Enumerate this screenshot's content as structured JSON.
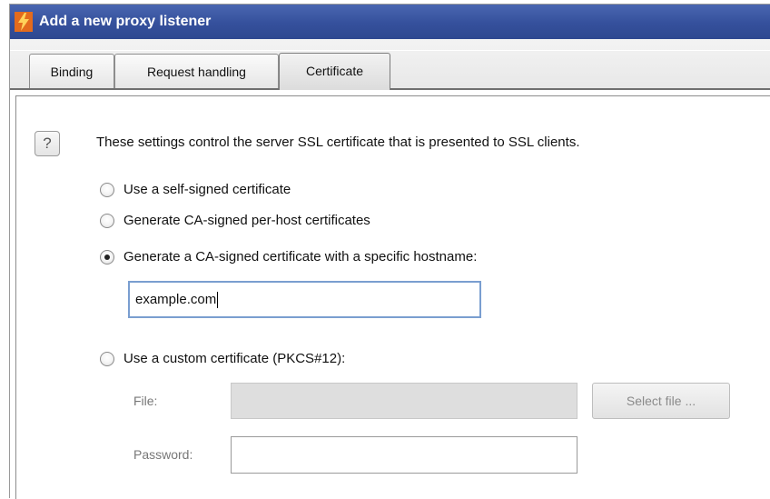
{
  "window": {
    "title": "Add a new proxy listener",
    "icon": "lightning-app-icon"
  },
  "tabs": [
    {
      "label": "Binding",
      "active": false
    },
    {
      "label": "Request handling",
      "active": false
    },
    {
      "label": "Certificate",
      "active": true
    }
  ],
  "certificate": {
    "help_label": "?",
    "description": "These settings control the server SSL certificate that is presented to SSL clients.",
    "options": [
      {
        "label": "Use a self-signed certificate",
        "selected": false
      },
      {
        "label": "Generate CA-signed per-host certificates",
        "selected": false
      },
      {
        "label": "Generate a CA-signed certificate with a specific hostname:",
        "selected": true
      },
      {
        "label": "Use a custom certificate (PKCS#12):",
        "selected": false
      }
    ],
    "hostname_value": "example.com",
    "file_label": "File:",
    "file_value": "",
    "select_file_label": "Select file ...",
    "password_label": "Password:",
    "password_value": ""
  },
  "colors": {
    "titlebar": "#35509c",
    "focus_border": "#7a9ed0",
    "disabled_field": "#dedede"
  }
}
